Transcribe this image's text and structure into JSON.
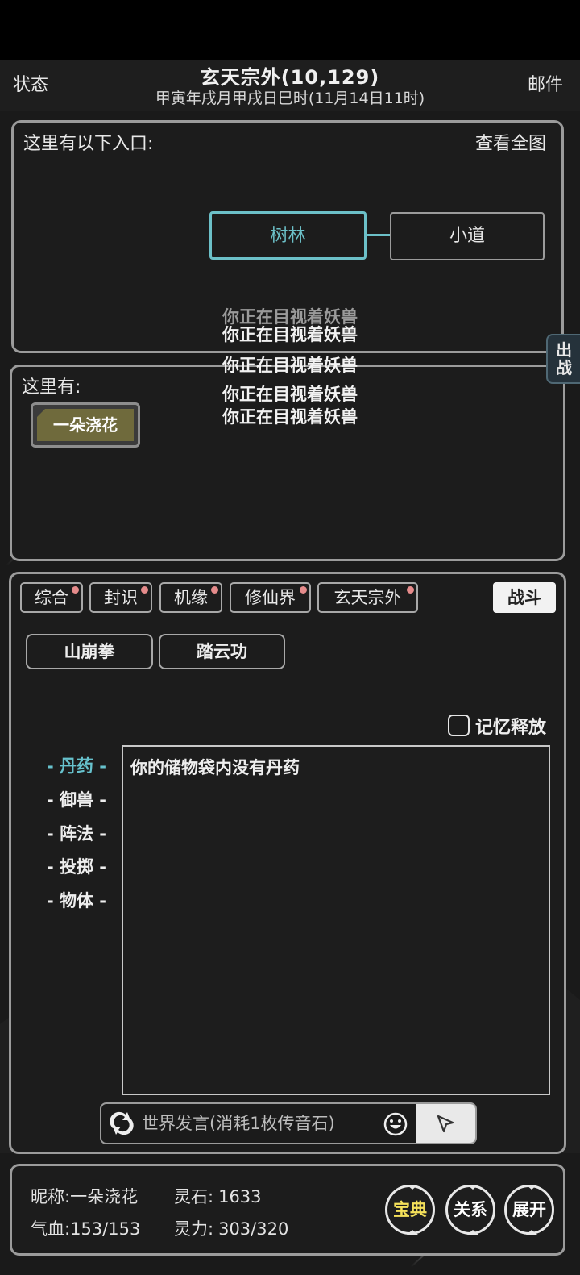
{
  "header": {
    "status_label": "状态",
    "mail_label": "邮件",
    "location_title": "玄天宗外(10,129)",
    "datetime": "甲寅年戌月甲戌日巳时(11月14日11时)"
  },
  "entrances": {
    "label": "这里有以下入口:",
    "view_map_label": "查看全图",
    "nodes": [
      {
        "label": "树林",
        "active": true
      },
      {
        "label": "小道",
        "active": false
      }
    ]
  },
  "notifications": [
    "你正在目视着妖兽",
    "你正在目视着妖兽",
    "你正在目视着妖兽",
    "你正在目视着妖兽",
    "你正在目视着妖兽"
  ],
  "side_tab": {
    "label_top": "出",
    "label_bottom": "战"
  },
  "here": {
    "label": "这里有:",
    "npc_name": "一朵浇花"
  },
  "tabs": [
    {
      "label": "综合",
      "dot": true
    },
    {
      "label": "封识",
      "dot": true
    },
    {
      "label": "机缘",
      "dot": true
    },
    {
      "label": "修仙界",
      "dot": true
    },
    {
      "label": "玄天宗外",
      "dot": true
    }
  ],
  "fight_label": "战斗",
  "skills": [
    "山崩拳",
    "踏云功"
  ],
  "memory_release_label": "记忆释放",
  "categories": [
    {
      "label": "- 丹药 -",
      "active": true
    },
    {
      "label": "- 御兽 -",
      "active": false
    },
    {
      "label": "- 阵法 -",
      "active": false
    },
    {
      "label": "- 投掷 -",
      "active": false
    },
    {
      "label": "- 物体 -",
      "active": false
    }
  ],
  "inventory_message": "你的储物袋内没有丹药",
  "chat": {
    "placeholder": "世界发言(消耗1枚传音石)"
  },
  "player": {
    "nickname_label": "昵称:",
    "nickname": "一朵浇花",
    "spirit_stone_label": "灵石:",
    "spirit_stone": "1633",
    "hp_label": "气血:",
    "hp": "153/153",
    "mana_label": "灵力:",
    "mana": "303/320"
  },
  "bottom_buttons": [
    {
      "label": "宝典",
      "color": "#f5e15a"
    },
    {
      "label": "关系",
      "color": "#ffffff"
    },
    {
      "label": "展开",
      "color": "#ffffff"
    }
  ],
  "colors": {
    "accent": "#6cc0c8",
    "badge_dot": "#e58b8b",
    "treasure_text": "#f5e15a"
  }
}
